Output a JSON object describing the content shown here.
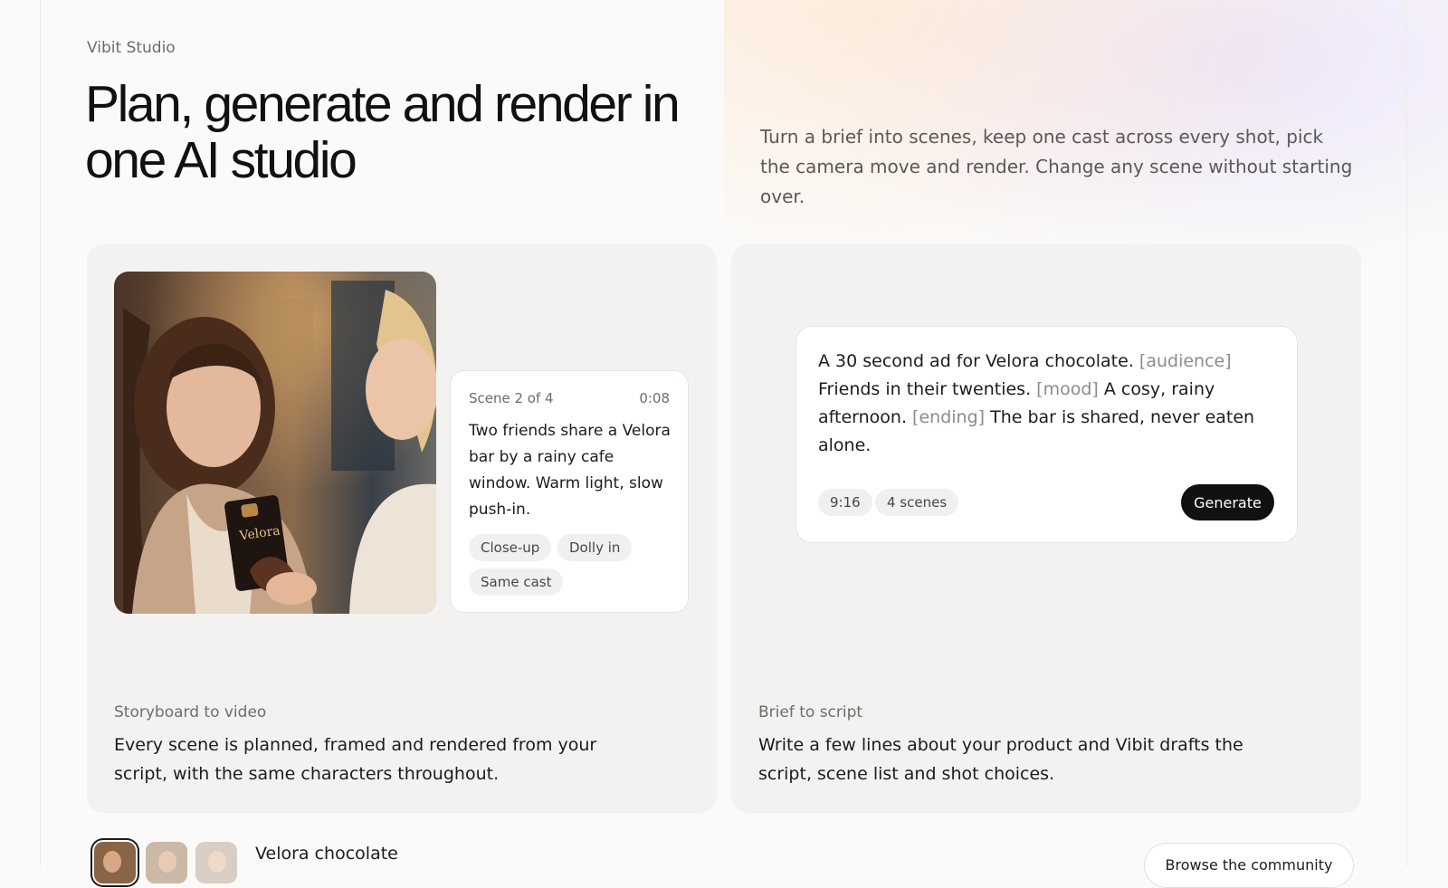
{
  "header": {
    "brand": "Vibit Studio",
    "headline": "Plan, generate and render in one AI studio",
    "subhead": "Turn a brief into scenes, keep one cast across every shot, pick the camera move and render. Change any scene without starting over."
  },
  "storyboard": {
    "scene_index": "Scene 2 of 4",
    "scene_time": "0:08",
    "scene_description": "Two friends share a Velora bar by a rainy cafe window. Warm light, slow push-in.",
    "chips": [
      "Close-up",
      "Dolly in",
      "Same cast"
    ],
    "product_label": "Velora",
    "caption_label": "Storyboard to video",
    "caption_text": "Every scene is planned, framed and rendered from your script, with the same characters throughout."
  },
  "brief": {
    "intro": "A 30 second ad for Velora chocolate.",
    "tag_audience": "[audience]",
    "audience": "Friends in their twenties.",
    "tag_mood": "[mood]",
    "mood": "A cosy, rainy afternoon.",
    "tag_ending": "[ending]",
    "ending": "The bar is shared, never eaten alone.",
    "chips": [
      "9:16",
      "4 scenes"
    ],
    "generate_label": "Generate",
    "caption_label": "Brief to script",
    "caption_text": "Write a few lines about your product and Vibit drafts the script, scene list and shot choices."
  },
  "footer": {
    "project_name": "Velora chocolate",
    "browse_label": "Browse the community"
  },
  "colors": {
    "background": "#fbfaf9",
    "card": "#f3f2f0",
    "button_dark": "#111111",
    "tag_muted": "#8f8b86"
  }
}
